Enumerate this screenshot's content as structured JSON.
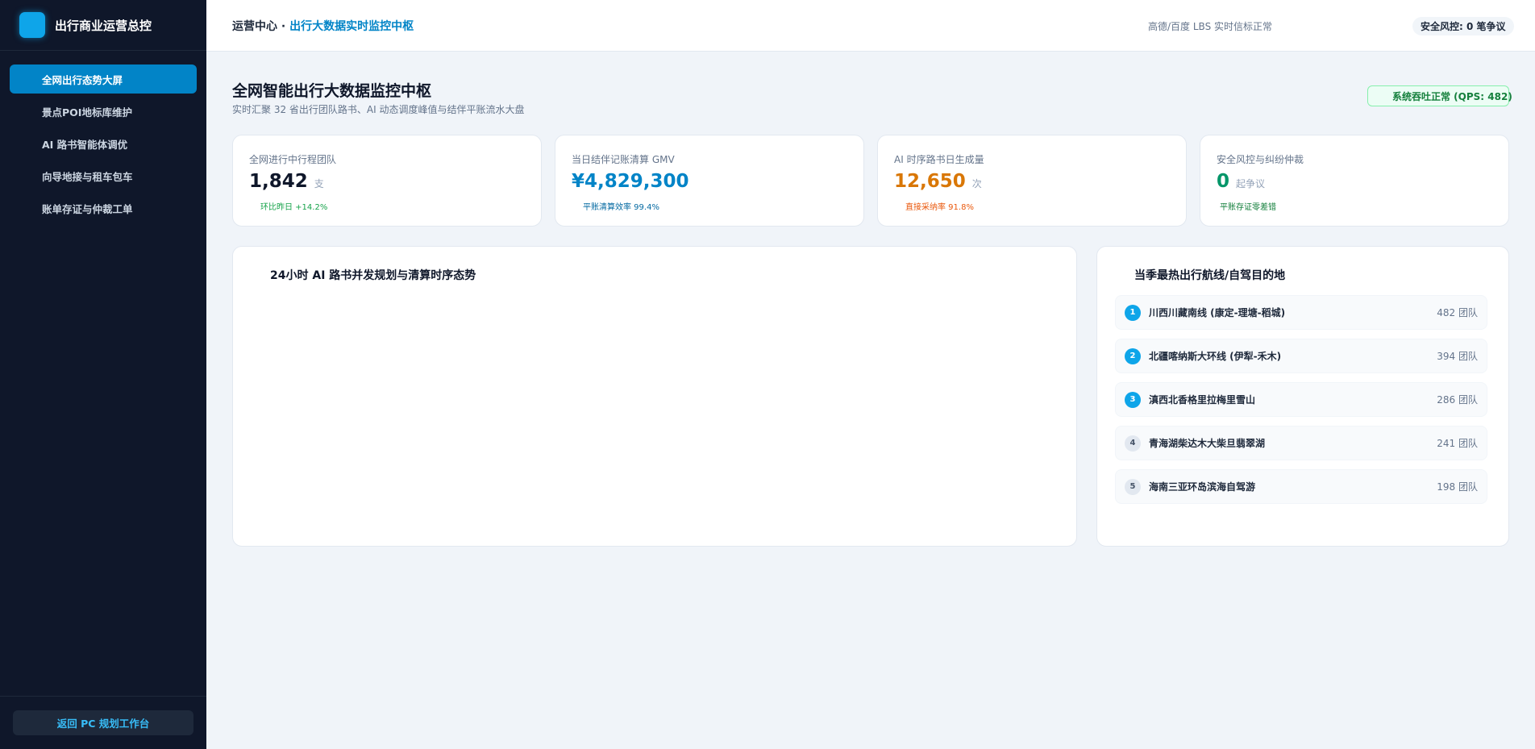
{
  "sidebar": {
    "title": "出行商业运营总控",
    "nav": [
      {
        "label": "全网出行态势大屏",
        "active": true
      },
      {
        "label": "景点POI地标库维护",
        "active": false
      },
      {
        "label": "AI 路书智能体调优",
        "active": false
      },
      {
        "label": "向导地接与租车包车",
        "active": false
      },
      {
        "label": "账单存证与仲裁工单",
        "active": false
      }
    ],
    "back_label": "返回 PC 规划工作台"
  },
  "topbar": {
    "crumb_root": "运营中心",
    "crumb_sep": " · ",
    "crumb_current": "出行大数据实时监控中枢",
    "lbs_status": "高德/百度 LBS 实时信标正常",
    "risk_badge": "安全风控: 0 笔争议"
  },
  "main": {
    "title": "全网智能出行大数据监控中枢",
    "subtitle": "实时汇聚 32 省出行团队路书、AI 动态调度峰值与结伴平账流水大盘",
    "system_badge": "系统吞吐正常 (QPS: 482)"
  },
  "kpis": [
    {
      "label": "全网进行中行程团队",
      "value": "1,842",
      "unit": "支",
      "foot": "环比昨日 +14.2%",
      "value_color": "#0f172a",
      "foot_color": "#16a34a"
    },
    {
      "label": "当日结伴记账清算 GMV",
      "value": "¥4,829,300",
      "unit": "",
      "foot": "平账清算效率 99.4%",
      "value_color": "#0284c7",
      "foot_color": "#0369a1"
    },
    {
      "label": "AI 时序路书日生成量",
      "value": "12,650",
      "unit": "次",
      "foot": "直接采纳率 91.8%",
      "value_color": "#d97706",
      "foot_color": "#ea580c"
    },
    {
      "label": "安全风控与纠纷仲裁",
      "value": "0",
      "unit": "起争议",
      "foot": "平账存证零差错",
      "value_color": "#059669",
      "foot_color": "#15803d"
    }
  ],
  "chart_panel": {
    "title": "24小时 AI 路书并发规划与清算时序态势"
  },
  "ranking": {
    "title": "当季最热出行航线/自驾目的地",
    "items": [
      {
        "rank": "1",
        "name": "川西川藏南线 (康定-理塘-稻城)",
        "count": "482 团队",
        "hot": true
      },
      {
        "rank": "2",
        "name": "北疆喀纳斯大环线 (伊犁-禾木)",
        "count": "394 团队",
        "hot": true
      },
      {
        "rank": "3",
        "name": "滇西北香格里拉梅里雪山",
        "count": "286 团队",
        "hot": true
      },
      {
        "rank": "4",
        "name": "青海湖柴达木大柴旦翡翠湖",
        "count": "241 团队",
        "hot": false
      },
      {
        "rank": "5",
        "name": "海南三亚环岛滨海自驾游",
        "count": "198 团队",
        "hot": false
      }
    ]
  }
}
